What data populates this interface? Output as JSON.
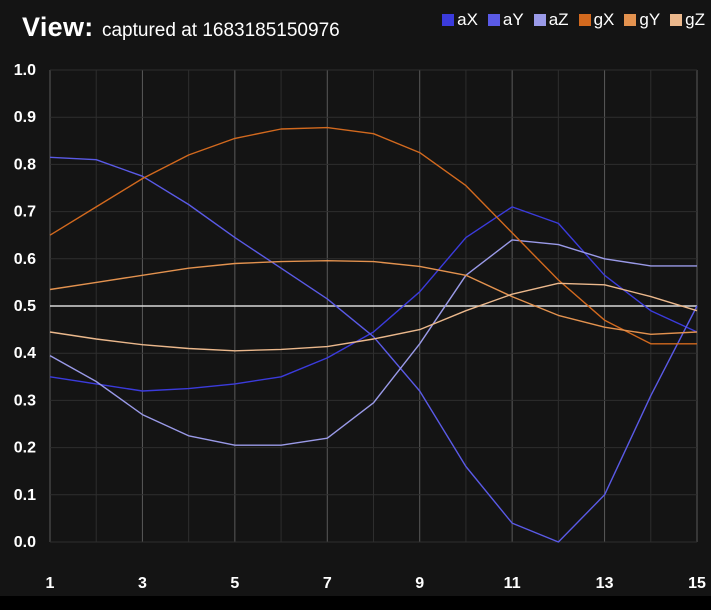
{
  "header": {
    "view_label": "View:",
    "caption": "captured at 1683185150976"
  },
  "colors": {
    "background": "#141414",
    "grid_minor": "#2e2e2e",
    "grid_major": "#5a5a5a",
    "baseline": "#d8d8d8"
  },
  "chart_data": {
    "type": "line",
    "title": "",
    "xlabel": "",
    "ylabel": "",
    "xlim": [
      1,
      15
    ],
    "ylim": [
      0,
      1
    ],
    "x": [
      1,
      2,
      3,
      4,
      5,
      6,
      7,
      8,
      9,
      10,
      11,
      12,
      13,
      14,
      15
    ],
    "x_ticks": [
      1,
      3,
      5,
      7,
      9,
      11,
      13,
      15
    ],
    "y_ticks": [
      "0.0",
      "0.1",
      "0.2",
      "0.3",
      "0.4",
      "0.5",
      "0.6",
      "0.7",
      "0.8",
      "0.9",
      "1.0"
    ],
    "reference_line": 0.5,
    "grid": true,
    "legend_position": "top-right",
    "series": [
      {
        "name": "aX",
        "color": "#3b3bdc",
        "values": [
          0.35,
          0.335,
          0.32,
          0.325,
          0.335,
          0.35,
          0.39,
          0.445,
          0.53,
          0.645,
          0.71,
          0.675,
          0.565,
          0.49,
          0.445
        ]
      },
      {
        "name": "aY",
        "color": "#5a5ae6",
        "values": [
          0.815,
          0.81,
          0.775,
          0.715,
          0.645,
          0.58,
          0.515,
          0.435,
          0.32,
          0.16,
          0.04,
          0.0,
          0.1,
          0.31,
          0.5
        ]
      },
      {
        "name": "aZ",
        "color": "#9a9ae8",
        "values": [
          0.395,
          0.34,
          0.27,
          0.225,
          0.205,
          0.205,
          0.22,
          0.295,
          0.42,
          0.565,
          0.64,
          0.63,
          0.6,
          0.585,
          0.585
        ]
      },
      {
        "name": "gX",
        "color": "#d2691e",
        "values": [
          0.65,
          0.71,
          0.77,
          0.82,
          0.855,
          0.875,
          0.878,
          0.865,
          0.825,
          0.755,
          0.655,
          0.555,
          0.47,
          0.42,
          0.42
        ]
      },
      {
        "name": "gY",
        "color": "#e3924f",
        "values": [
          0.535,
          0.55,
          0.565,
          0.58,
          0.59,
          0.594,
          0.596,
          0.594,
          0.584,
          0.565,
          0.52,
          0.48,
          0.455,
          0.44,
          0.445
        ]
      },
      {
        "name": "gZ",
        "color": "#ebb88c",
        "values": [
          0.445,
          0.43,
          0.418,
          0.41,
          0.405,
          0.408,
          0.414,
          0.43,
          0.45,
          0.49,
          0.525,
          0.548,
          0.545,
          0.52,
          0.49
        ]
      }
    ]
  }
}
